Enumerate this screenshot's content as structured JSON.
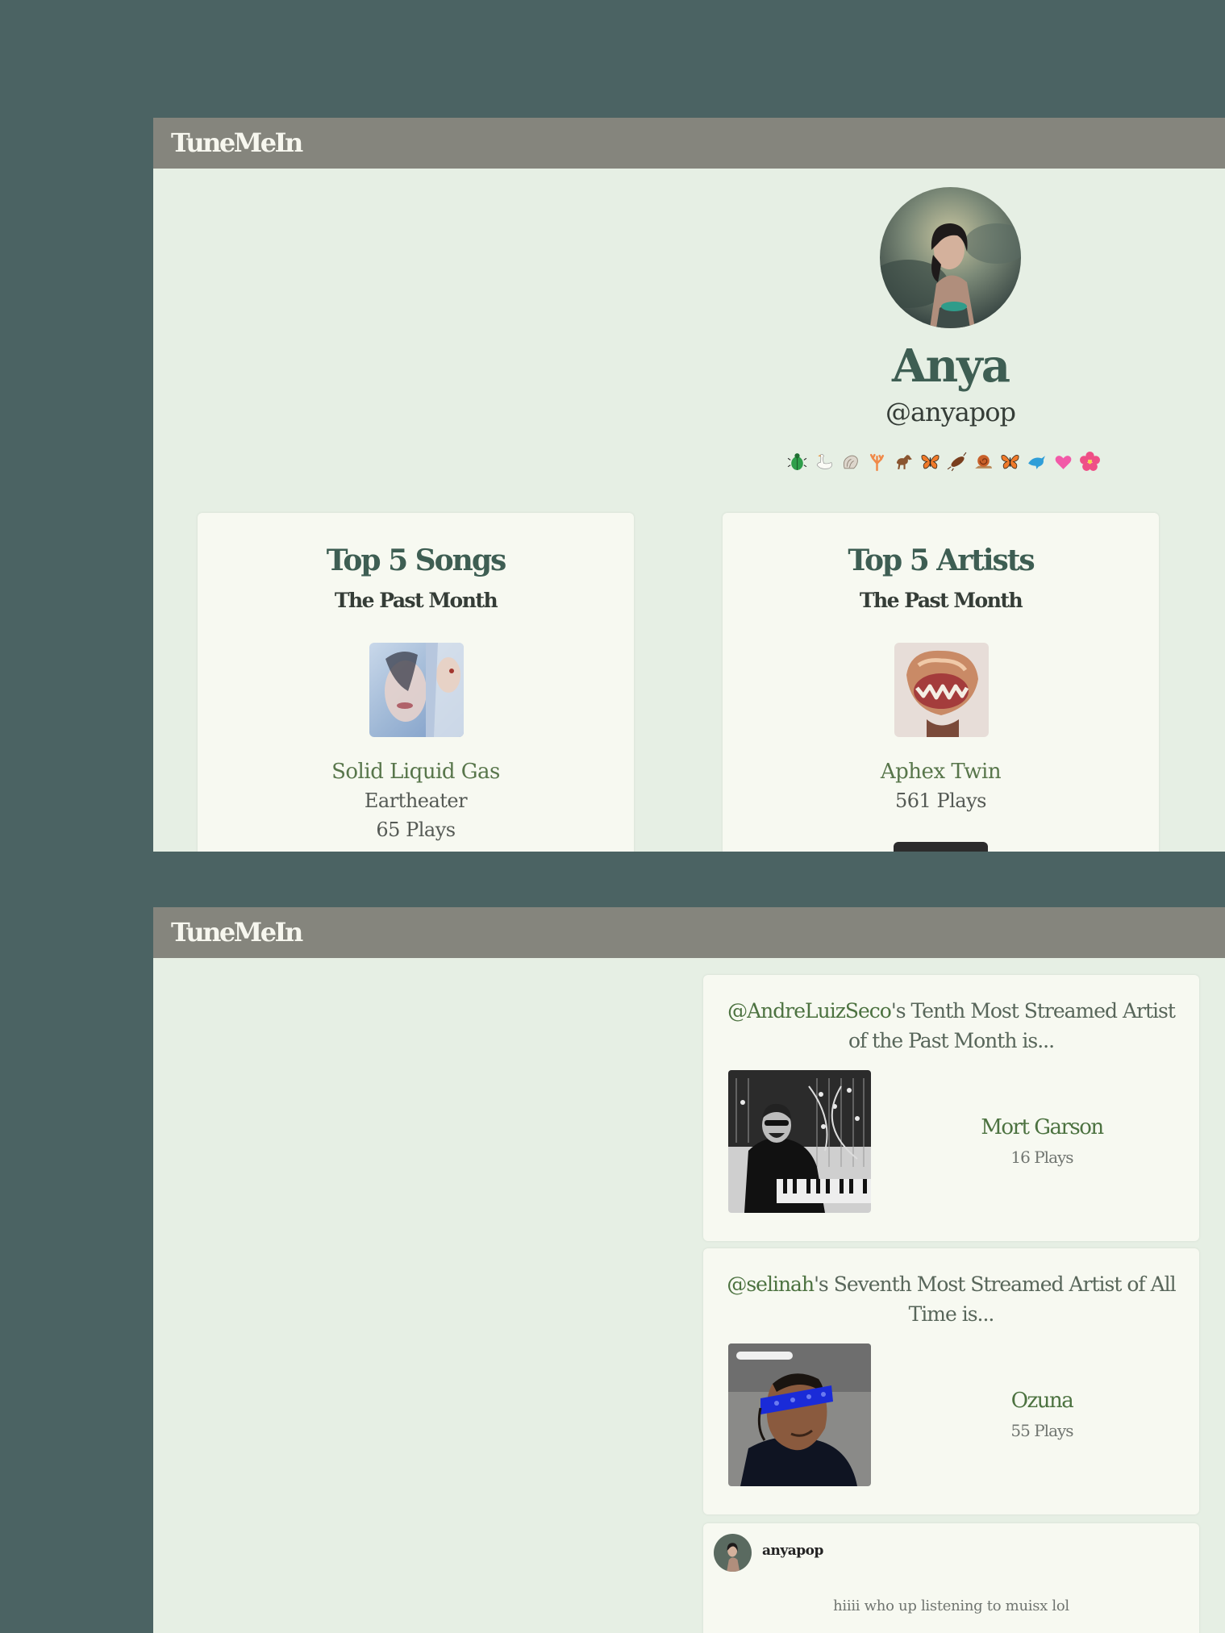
{
  "app": {
    "logo": "TuneMeIn"
  },
  "profile": {
    "name": "Anya",
    "handle": "@anyapop",
    "emojis": [
      "beetle-icon",
      "swan-icon",
      "shell-icon",
      "coral-icon",
      "horse-icon",
      "butterfly-icon",
      "cockroach-icon",
      "snail-icon",
      "butterfly-icon",
      "dolphin-icon",
      "pink-heart-icon",
      "hibiscus-icon"
    ]
  },
  "top_songs": {
    "title": "Top 5 Songs",
    "subtitle": "The Past Month",
    "first": {
      "song": "Solid Liquid Gas",
      "artist": "Eartheater",
      "plays": "65 Plays"
    }
  },
  "top_artists": {
    "title": "Top 5 Artists",
    "subtitle": "The Past Month",
    "first": {
      "artist": "Aphex Twin",
      "plays": "561 Plays"
    }
  },
  "feed": [
    {
      "user": "@AndreLuizSeco",
      "title_rest": "'s Tenth Most Streamed Artist of the Past Month is...",
      "artist": "Mort Garson",
      "plays": "16 Plays"
    },
    {
      "user": "@selinah",
      "title_rest": "'s Seventh Most Streamed Artist of All Time is...",
      "artist": "Ozuna",
      "plays": "55 Plays"
    }
  ],
  "post": {
    "user": "anyapop",
    "text": "hiiii who up listening to muisx lol"
  },
  "colors": {
    "background": "#4b6363",
    "topbar": "#85857d",
    "panel": "#e6efe4",
    "card": "#f7f9f1",
    "accent": "#3e5e53",
    "link": "#4c7240"
  }
}
